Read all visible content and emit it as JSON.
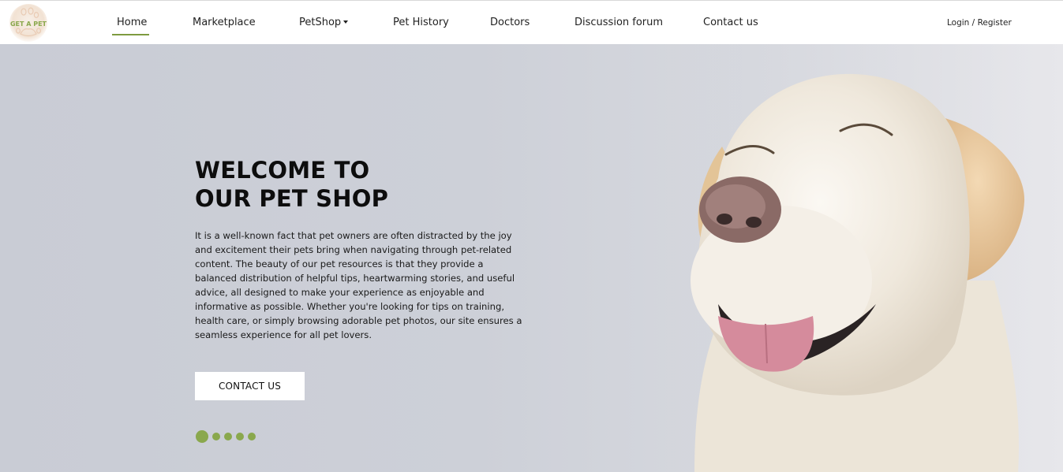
{
  "brand": {
    "logo_text": "GET A PET",
    "accent_color": "#8aa84d"
  },
  "nav": {
    "items": [
      {
        "label": "Home",
        "active": true
      },
      {
        "label": "Marketplace",
        "active": false
      },
      {
        "label": "PetShop",
        "active": false,
        "has_dropdown": true
      },
      {
        "label": "Pet History",
        "active": false
      },
      {
        "label": "Doctors",
        "active": false
      },
      {
        "label": "Discussion forum",
        "active": false
      },
      {
        "label": "Contact us",
        "active": false
      }
    ],
    "login_label": "Login",
    "separator": "/",
    "register_label": "Register"
  },
  "hero": {
    "title_line1": "WELCOME TO",
    "title_line2": "OUR PET SHOP",
    "paragraph": "It is a well-known fact that pet owners are often distracted by the joy and excitement their pets bring when navigating through pet-related content. The beauty of our pet resources is that they provide a balanced distribution of helpful tips, heartwarming stories, and useful advice, all designed to make your experience as enjoyable and informative as possible. Whether you're looking for tips on training, health care, or simply browsing adorable pet photos, our site ensures a seamless experience for all pet lovers.",
    "cta_label": "CONTACT US",
    "carousel": {
      "slide_count": 5,
      "active_index": 0
    },
    "image_subject": "labrador-dog-photo"
  }
}
